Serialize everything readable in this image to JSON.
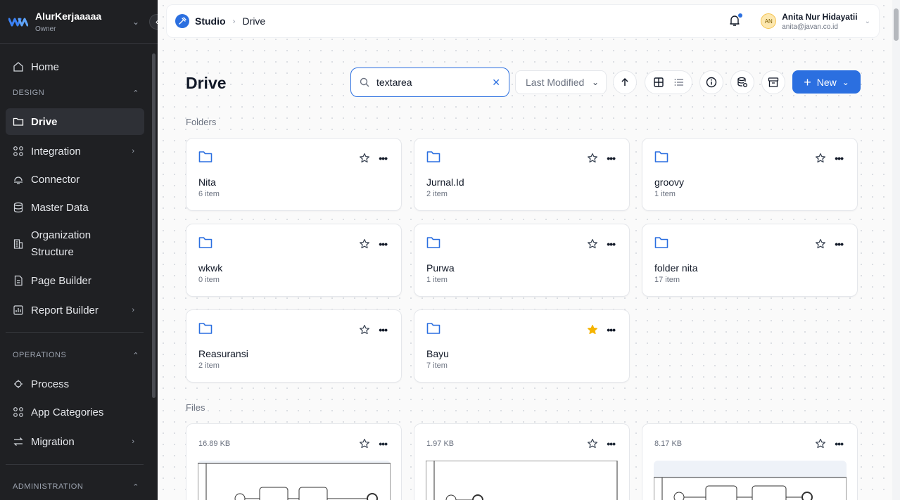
{
  "sidebar": {
    "org_name": "AlurKerjaaaaa",
    "org_role": "Owner",
    "home": "Home",
    "section_design": "DESIGN",
    "design_items": [
      {
        "label": "Drive",
        "icon": "folder-icon",
        "active": true
      },
      {
        "label": "Integration",
        "icon": "integration-icon"
      },
      {
        "label": "Connector",
        "icon": "connector-icon"
      },
      {
        "label": "Master Data",
        "icon": "database-icon"
      },
      {
        "label": "Organization Structure",
        "icon": "building-icon"
      },
      {
        "label": "Page Builder",
        "icon": "page-icon"
      },
      {
        "label": "Report Builder",
        "icon": "report-icon"
      }
    ],
    "section_operations": "OPERATIONS",
    "operations_items": [
      {
        "label": "Process",
        "icon": "process-icon"
      },
      {
        "label": "App Categories",
        "icon": "grid-icon"
      },
      {
        "label": "Migration",
        "icon": "migration-icon"
      }
    ],
    "section_administration": "ADMINISTRATION"
  },
  "header": {
    "breadcrumb_root": "Studio",
    "breadcrumb_current": "Drive",
    "user_initials": "AN",
    "user_name": "Anita Nur Hidayatii",
    "user_email": "anita@javan.co.id"
  },
  "main": {
    "title": "Drive",
    "search_value": "textarea",
    "sort_label": "Last Modified",
    "new_label": "New",
    "folders_label": "Folders",
    "files_label": "Files",
    "folders": [
      {
        "name": "Nita",
        "count": "6 item",
        "starred": false
      },
      {
        "name": "Jurnal.Id",
        "count": "2 item",
        "starred": false
      },
      {
        "name": "groovy",
        "count": "1 item",
        "starred": false
      },
      {
        "name": "wkwk",
        "count": "0 item",
        "starred": false
      },
      {
        "name": "Purwa",
        "count": "1 item",
        "starred": false
      },
      {
        "name": "folder nita",
        "count": "17 item",
        "starred": false
      },
      {
        "name": "Reasuransi",
        "count": "2 item",
        "starred": false
      },
      {
        "name": "Bayu",
        "count": "7 item",
        "starred": true
      }
    ],
    "files": [
      {
        "size": "16.89 KB"
      },
      {
        "size": "1.97 KB"
      },
      {
        "size": "8.17 KB"
      }
    ]
  },
  "colors": {
    "accent": "#2b6fe0",
    "star": "#f5b400",
    "sidebar": "#1f2023"
  }
}
